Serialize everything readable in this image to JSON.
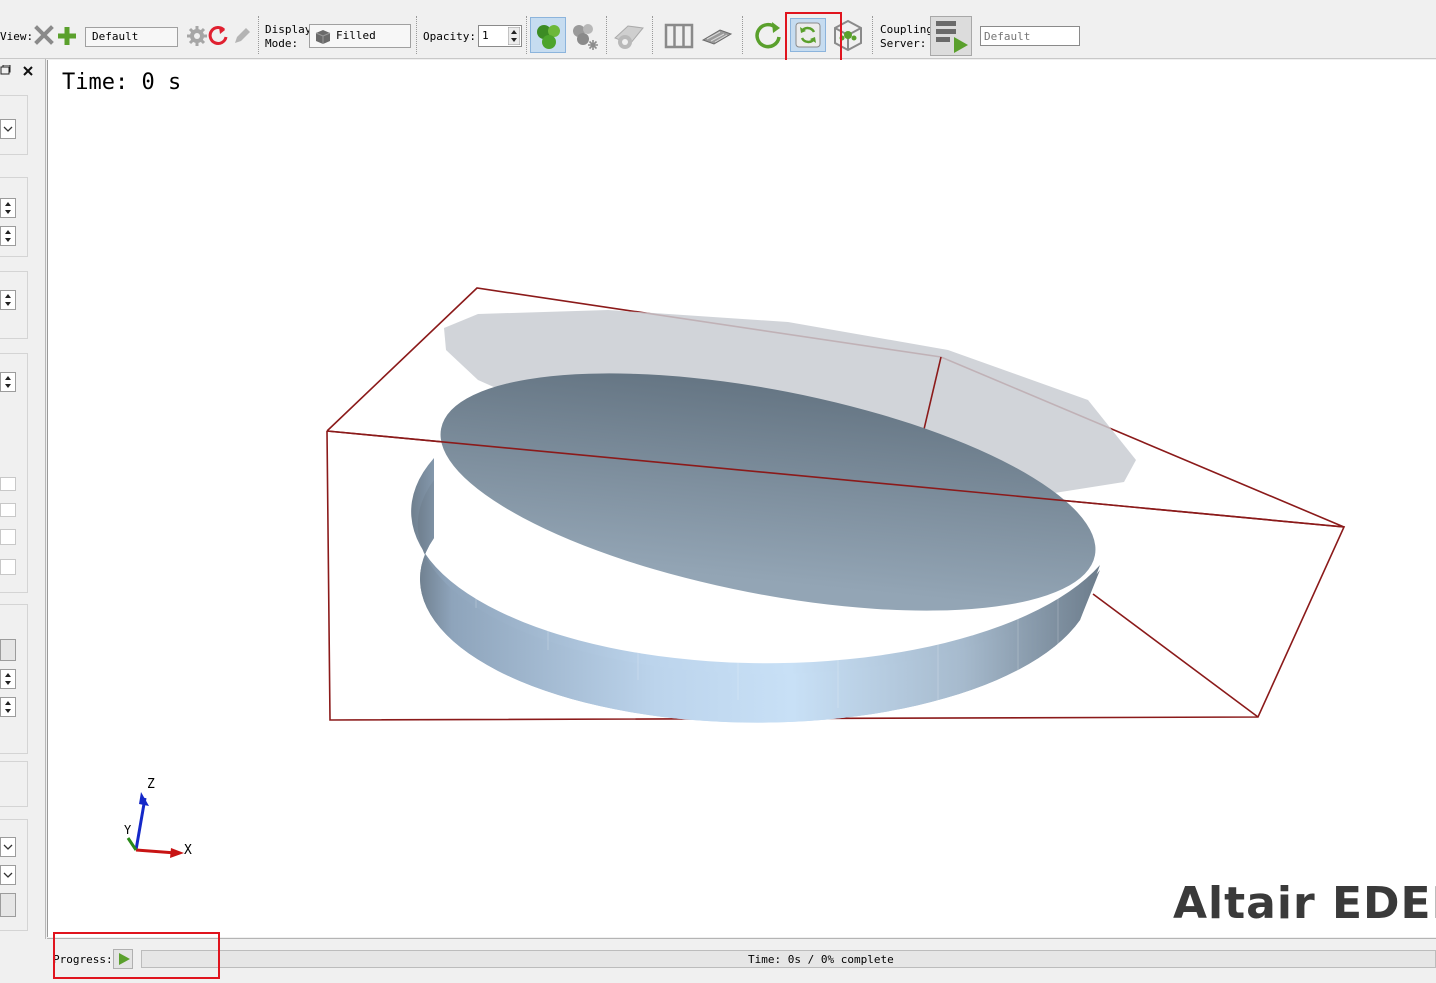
{
  "toolbar": {
    "view_label": "View:",
    "view_combo": "Default",
    "display_mode_label_line1": "Display",
    "display_mode_label_line2": "Mode:",
    "display_mode_value": "Filled",
    "opacity_label": "Opacity:",
    "opacity_value": "1",
    "coupling_label_line1": "Coupling",
    "coupling_label_line2": "Server:",
    "coupling_server_placeholder": "Default"
  },
  "viewport": {
    "time_text": "Time: 0 s",
    "brand_text": "Altair EDEM",
    "axes": {
      "z": "Z",
      "y": "Y",
      "x": "X"
    }
  },
  "statusbar": {
    "progress_label": "Progress:",
    "progress_fraction": 0,
    "status_text": "Time: 0s / 0% complete"
  },
  "colors": {
    "highlight": "#e0141e",
    "bounding_box": "#8b1a1a",
    "accent_green": "#5aa02c"
  }
}
